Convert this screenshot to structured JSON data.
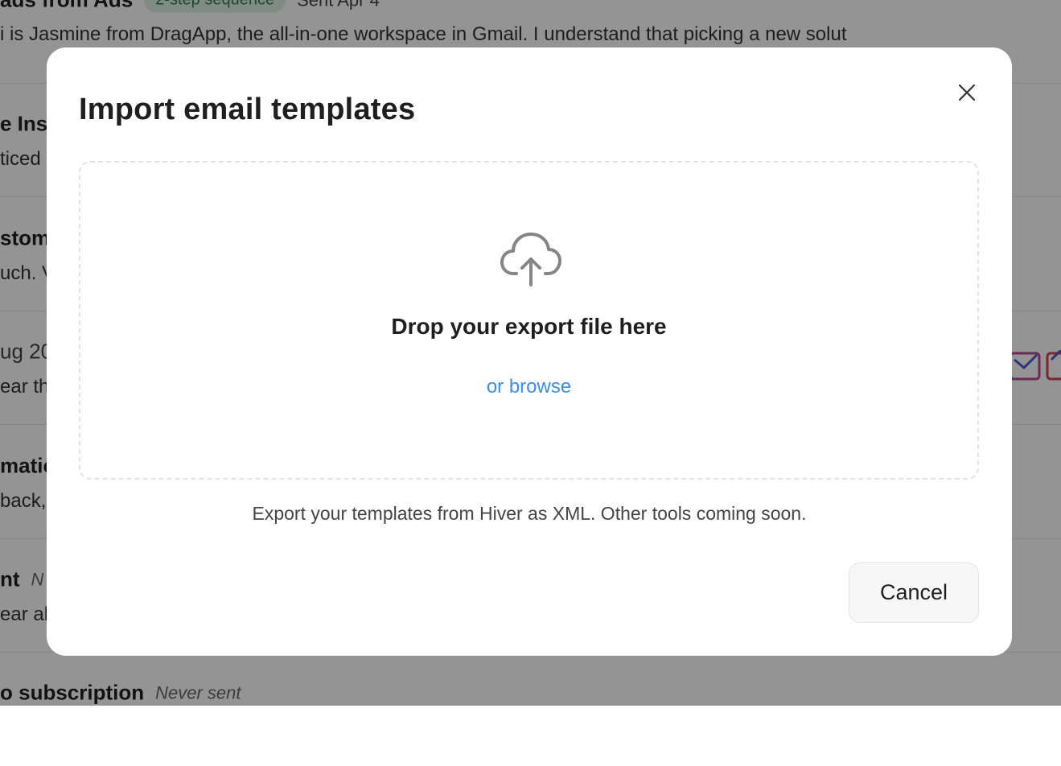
{
  "background_list": {
    "rows": [
      {
        "title": "ads from Ads",
        "badge": "2-step sequence",
        "meta": "Sent Apr 4",
        "snippet": "i is Jasmine from DragApp, the all-in-one workspace in Gmail. I understand that picking a new solut"
      },
      {
        "title": "e Inst",
        "snippet": "ticed"
      },
      {
        "title": "stome",
        "snippet": "uch. V"
      },
      {
        "title": "ug 20",
        "snippet": "ear th"
      },
      {
        "title": "matic",
        "snippet": "back, v"
      },
      {
        "title": "nt",
        "meta": "N",
        "snippet": "ear ab"
      },
      {
        "title": "o subscription",
        "meta": "Never sent"
      }
    ]
  },
  "modal": {
    "title": "Import email templates",
    "close_icon": "close-icon",
    "dropzone": {
      "icon": "cloud-upload-icon",
      "title": "Drop your export file here",
      "browse_label": "or browse"
    },
    "help_text": "Export your templates from Hiver as XML. Other tools coming soon.",
    "cancel_label": "Cancel"
  },
  "colors": {
    "overlay": "rgba(0,0,0,0.42)",
    "link": "#3a8ee6",
    "badge_text": "#2e7d4f",
    "badge_bg": "#dcefe2"
  }
}
